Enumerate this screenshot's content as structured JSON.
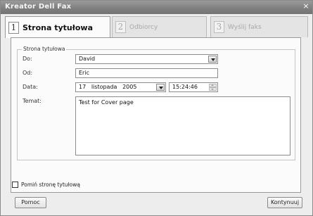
{
  "window": {
    "title": "Kreator Dell Fax",
    "close_glyph": "×"
  },
  "tabs": [
    {
      "num": "1",
      "label": "Strona tytułowa",
      "active": true
    },
    {
      "num": "2",
      "label": "Odbiorcy",
      "active": false
    },
    {
      "num": "3",
      "label": "Wyślij faks",
      "active": false
    }
  ],
  "cover": {
    "group_label": "Strona tytułowa",
    "to": {
      "label": "Do:",
      "value": "David"
    },
    "from": {
      "label": "Od:",
      "value": "Eric"
    },
    "date": {
      "label": "Data:",
      "day": "17",
      "month": "listopada",
      "year": "2005",
      "time": "15:24:46"
    },
    "subject": {
      "label": "Temat:",
      "value": "Test for Cover page"
    }
  },
  "skip_cover": {
    "label": "Pomiń stronę tytułową",
    "checked": false
  },
  "buttons": {
    "help": "Pomoc",
    "continue": "Kontynuuj"
  }
}
